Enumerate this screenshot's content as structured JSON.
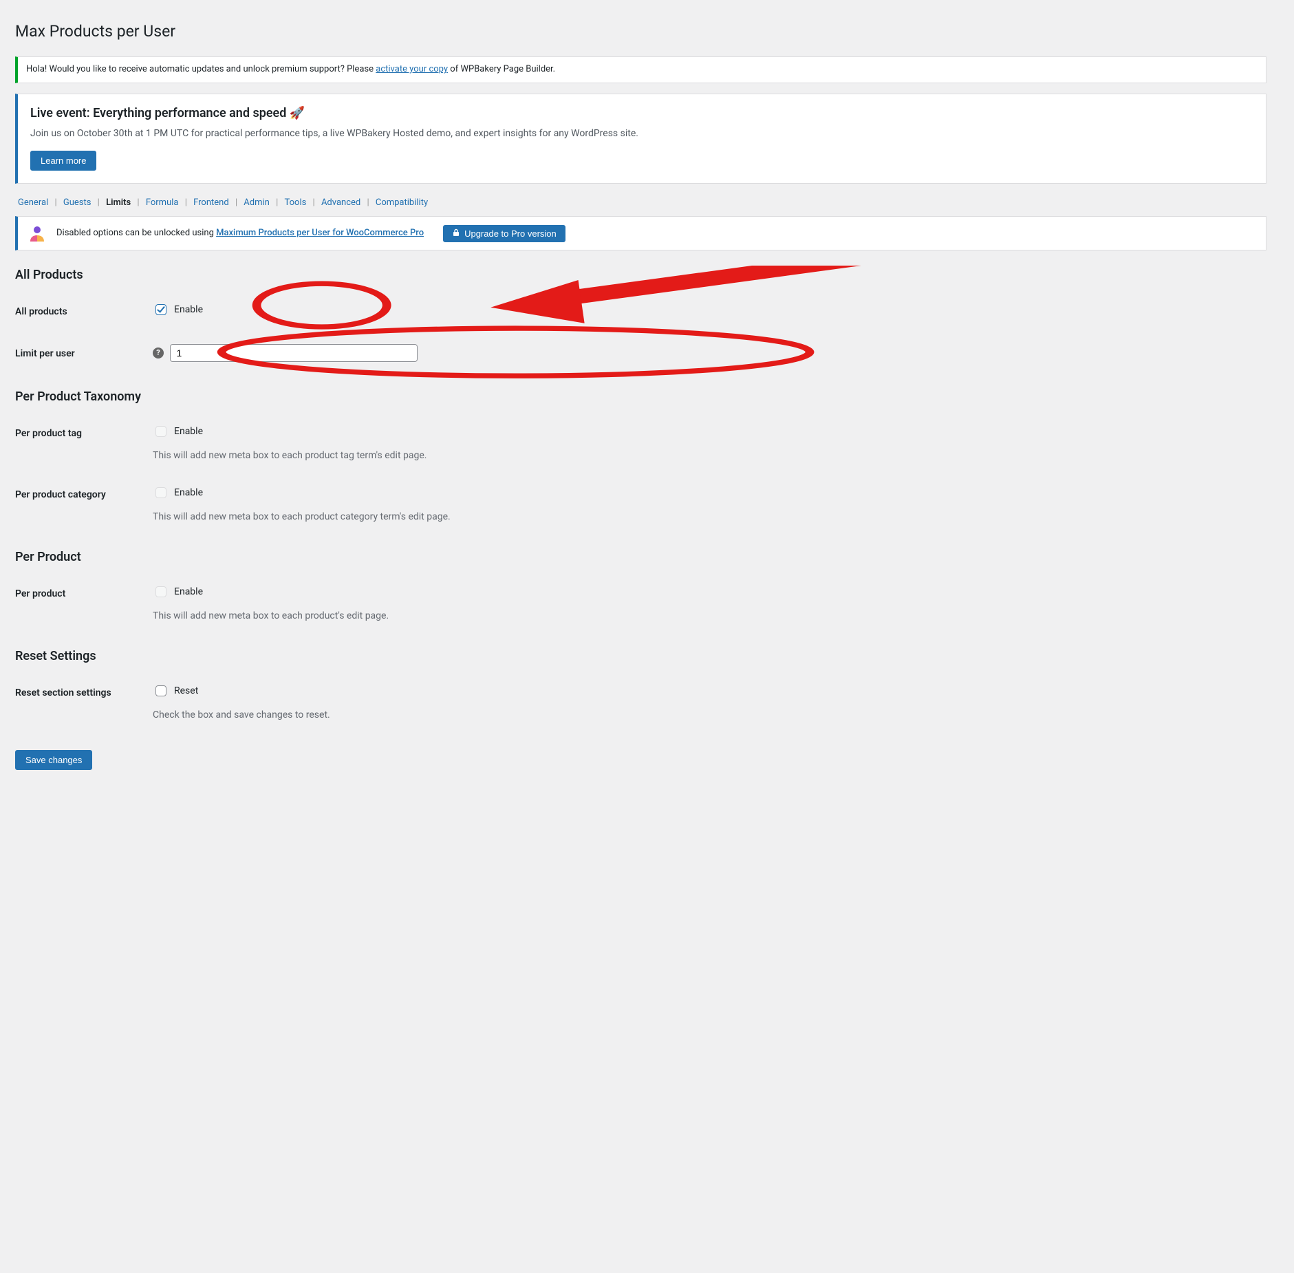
{
  "page_title": "Max Products per User",
  "activation_notice": {
    "prefix": "Hola! Would you like to receive automatic updates and unlock premium support? Please ",
    "link_text": "activate your copy",
    "suffix": " of WPBakery Page Builder."
  },
  "event_notice": {
    "title": "Live event: Everything performance and speed",
    "emoji": "🚀",
    "body": "Join us on October 30th at 1 PM UTC for practical performance tips, a live WPBakery Hosted demo, and expert insights for any WordPress site.",
    "button": "Learn more"
  },
  "tabs": [
    {
      "label": "General",
      "current": false
    },
    {
      "label": "Guests",
      "current": false
    },
    {
      "label": "Limits",
      "current": true
    },
    {
      "label": "Formula",
      "current": false
    },
    {
      "label": "Frontend",
      "current": false
    },
    {
      "label": "Admin",
      "current": false
    },
    {
      "label": "Tools",
      "current": false
    },
    {
      "label": "Advanced",
      "current": false
    },
    {
      "label": "Compatibility",
      "current": false
    }
  ],
  "pro_bar": {
    "message_prefix": "Disabled options can be unlocked using ",
    "link_text": "Maximum Products per User for WooCommerce Pro",
    "upgrade_button": "Upgrade to Pro version"
  },
  "sections": {
    "all_products": {
      "heading": "All Products",
      "rows": {
        "enable": {
          "label": "All products",
          "checkbox_label": "Enable",
          "checked": true
        },
        "limit": {
          "label": "Limit per user",
          "value": "1"
        }
      }
    },
    "per_taxonomy": {
      "heading": "Per Product Taxonomy",
      "rows": {
        "per_tag": {
          "label": "Per product tag",
          "checkbox_label": "Enable",
          "checked": false,
          "disabled": true,
          "description": "This will add new meta box to each product tag term's edit page."
        },
        "per_cat": {
          "label": "Per product category",
          "checkbox_label": "Enable",
          "checked": false,
          "disabled": true,
          "description": "This will add new meta box to each product category term's edit page."
        }
      }
    },
    "per_product": {
      "heading": "Per Product",
      "rows": {
        "per_product": {
          "label": "Per product",
          "checkbox_label": "Enable",
          "checked": false,
          "disabled": true,
          "description": "This will add new meta box to each product's edit page."
        }
      }
    },
    "reset": {
      "heading": "Reset Settings",
      "rows": {
        "reset": {
          "label": "Reset section settings",
          "checkbox_label": "Reset",
          "checked": false,
          "description": "Check the box and save changes to reset."
        }
      }
    }
  },
  "save_button": "Save changes"
}
